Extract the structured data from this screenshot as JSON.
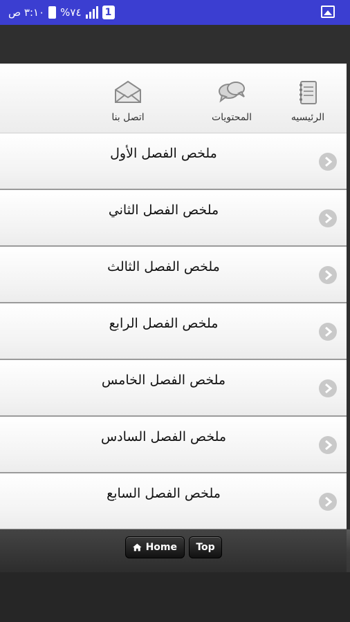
{
  "status_bar": {
    "time": "٣:١٠ ص",
    "battery_percent": "%٧٤",
    "sim_badge": "1",
    "gallery_icon": "image-icon"
  },
  "nav": {
    "items": [
      {
        "label": "الرئيسيه",
        "icon": "book-icon"
      },
      {
        "label": "المحتويات",
        "icon": "chat-bubbles-icon"
      },
      {
        "label": "اتصل بنا",
        "icon": "envelope-icon"
      }
    ]
  },
  "list": {
    "items": [
      {
        "label": "ملخص الفصل الأول"
      },
      {
        "label": "ملخص الفصل الثاني"
      },
      {
        "label": "ملخص الفصل الثالث"
      },
      {
        "label": "ملخص الفصل الرابع"
      },
      {
        "label": "ملخص الفصل الخامس"
      },
      {
        "label": "ملخص الفصل السادس"
      },
      {
        "label": "ملخص الفصل السابع"
      }
    ]
  },
  "footer": {
    "home_label": "Home",
    "top_label": "Top"
  },
  "colors": {
    "status_bar": "#3b3ed1",
    "row_border": "#9a9a9a",
    "arrow_circle": "#c9c9c9"
  }
}
